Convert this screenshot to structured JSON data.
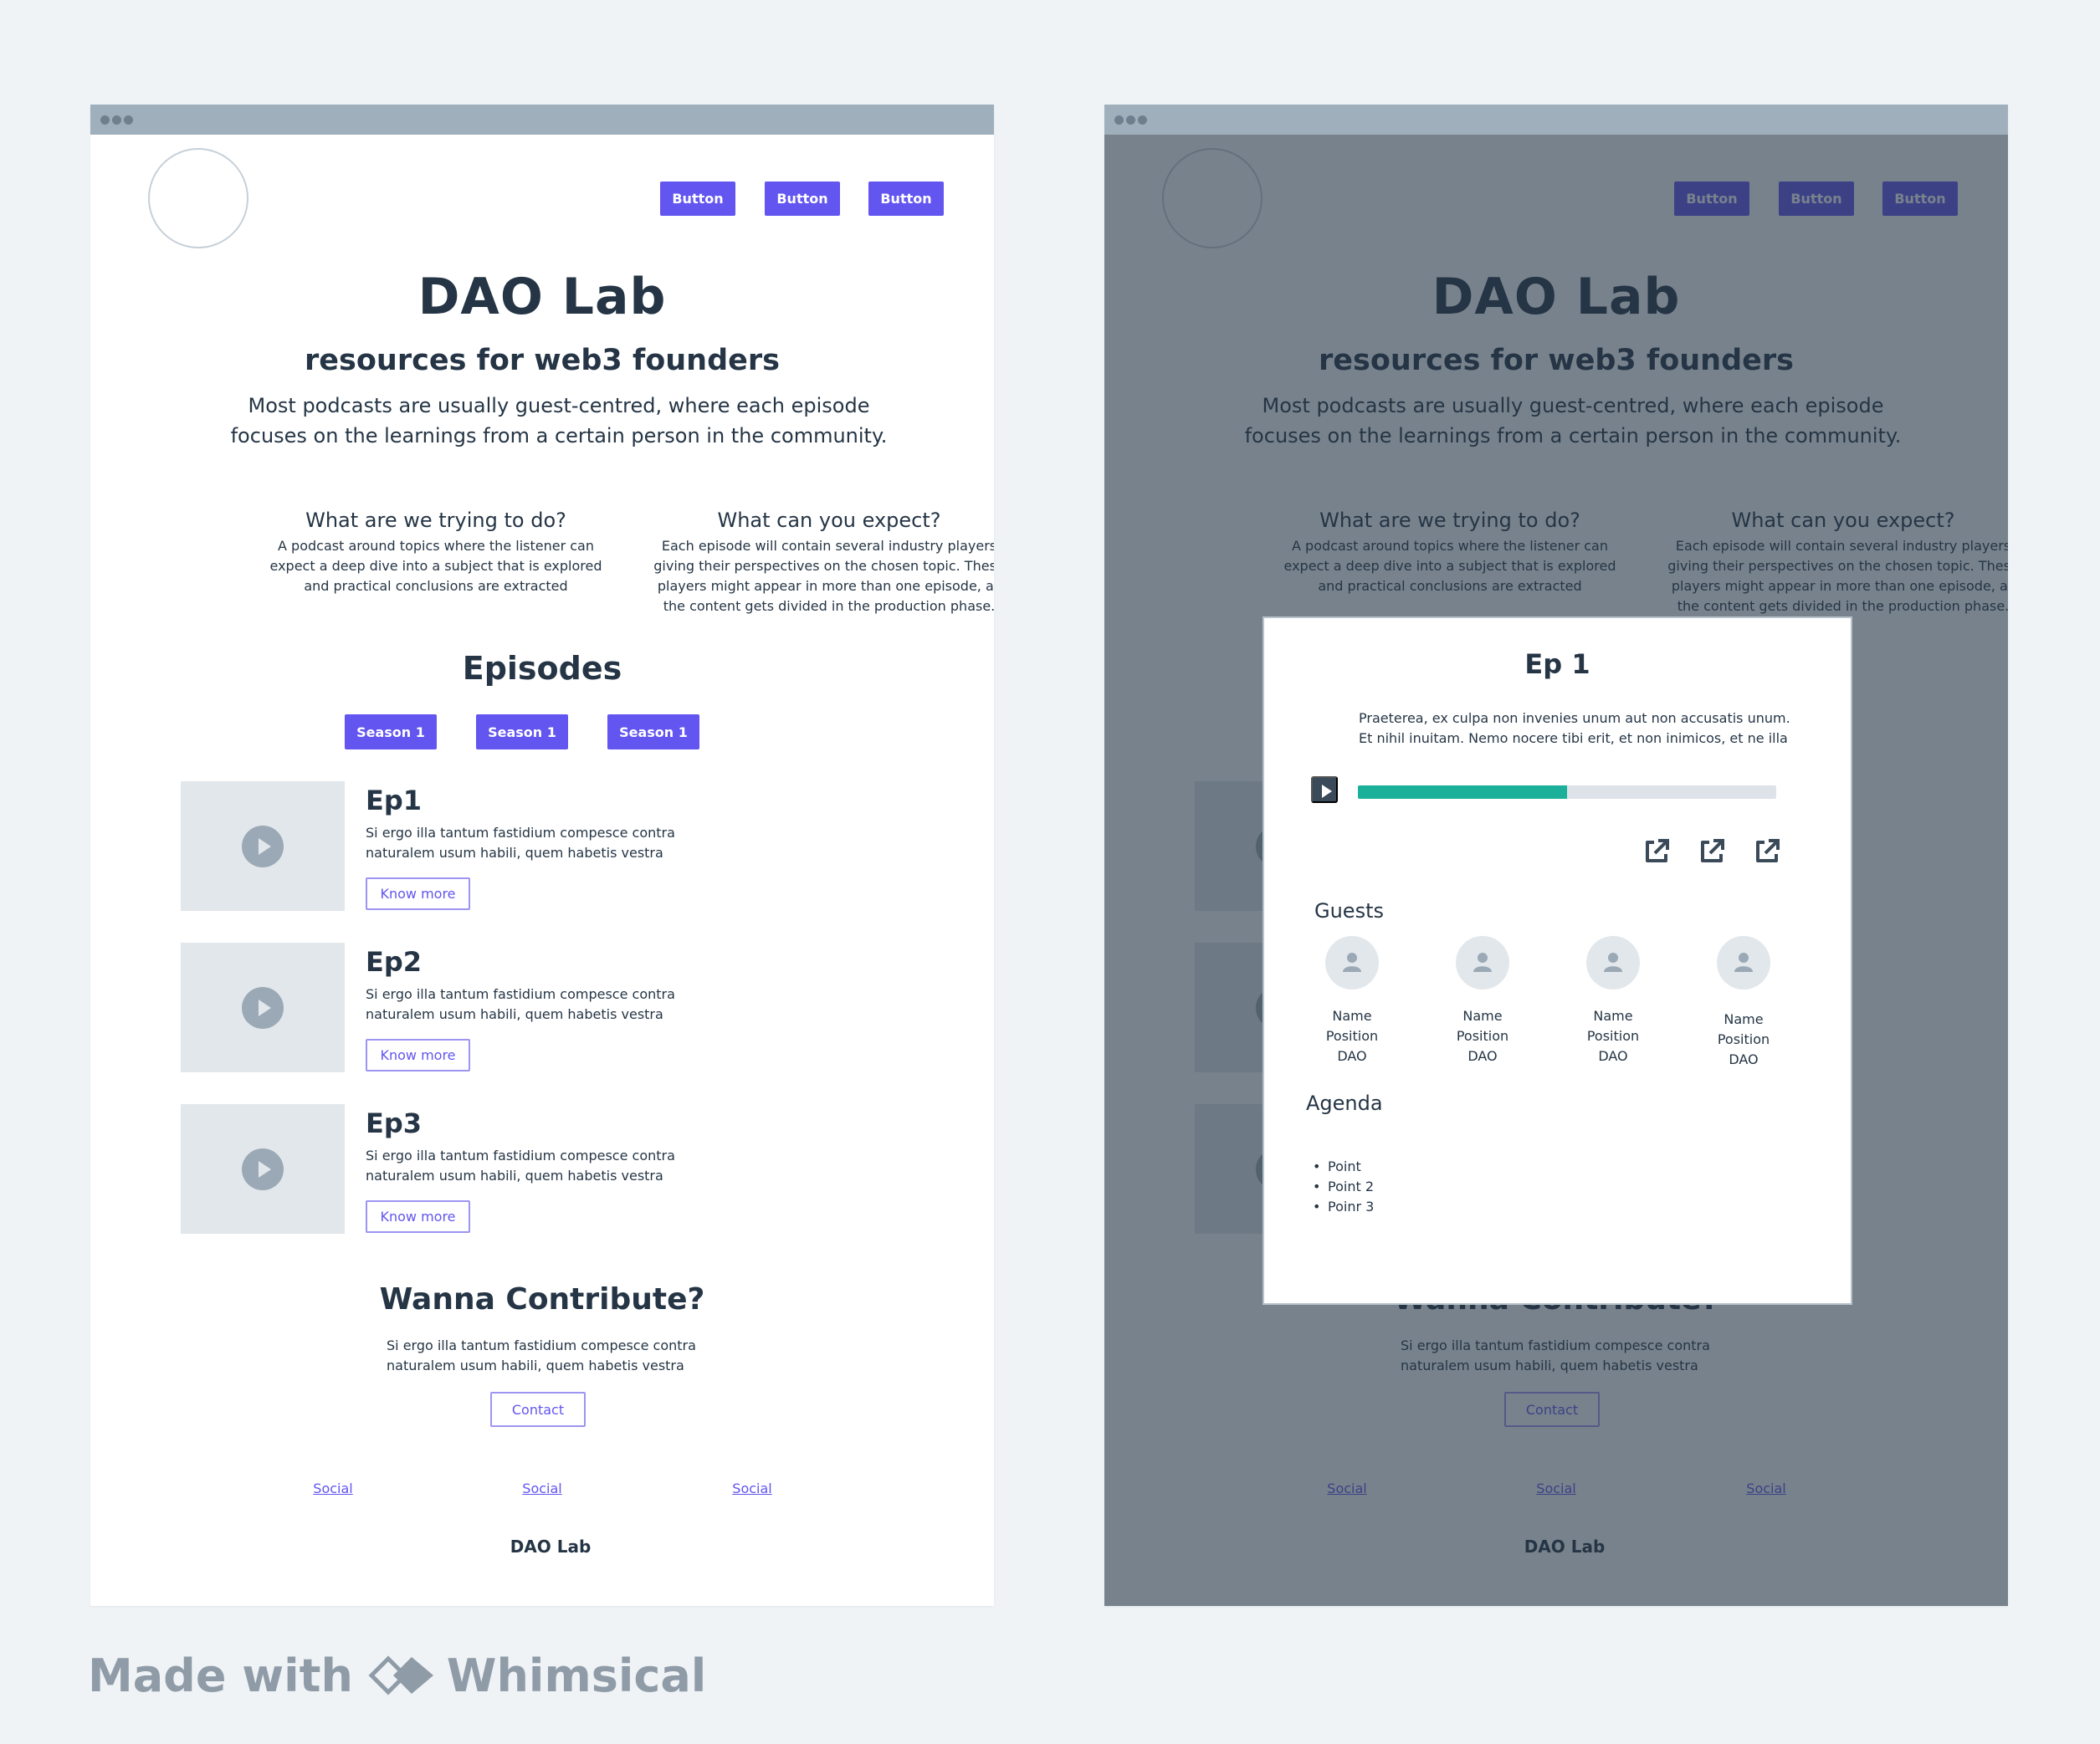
{
  "header": {
    "buttons": [
      "Button",
      "Button",
      "Button"
    ]
  },
  "hero": {
    "title": "DAO Lab",
    "subtitle": "resources for web3 founders",
    "description_line1": "Most podcasts are usually guest-centred, where each episode",
    "description_line2": "focuses on the learnings from a certain person in the community."
  },
  "info": [
    {
      "heading": "What are we trying to do?",
      "lines": [
        "A podcast around topics where the listener can",
        "expect a deep dive into a subject that is explored",
        "and practical conclusions are extracted"
      ]
    },
    {
      "heading": "What can you expect?",
      "lines": [
        "Each episode will contain several industry players",
        "giving their perspectives on the chosen topic. These",
        "players might appear in more than one episode, as",
        "the content gets divided in the production phase."
      ]
    }
  ],
  "episodes": {
    "heading": "Episodes",
    "seasons": [
      "Season 1",
      "Season 1",
      "Season 1"
    ],
    "items": [
      {
        "title": "Ep1",
        "line1": "Si ergo illa tantum fastidium compesce contra",
        "line2": "naturalem usum habili, quem habetis vestra",
        "button": "Know more"
      },
      {
        "title": "Ep2",
        "line1": "Si ergo illa tantum fastidium compesce contra",
        "line2": "naturalem usum habili, quem habetis vestra",
        "button": "Know more"
      },
      {
        "title": "Ep3",
        "line1": "Si ergo illa tantum fastidium compesce contra",
        "line2": "naturalem usum habili, quem habetis vestra",
        "button": "Know more"
      }
    ]
  },
  "contribute": {
    "heading": "Wanna Contribute?",
    "line1": "Si ergo illa tantum fastidium compesce contra",
    "line2": "naturalem usum habili, quem habetis vestra",
    "button": "Contact"
  },
  "footer": {
    "socials": [
      "Social",
      "Social",
      "Social"
    ],
    "brand": "DAO Lab"
  },
  "modal": {
    "title": "Ep 1",
    "desc_line1": "Praeterea, ex culpa non invenies unum aut non accusatis unum.",
    "desc_line2": "Et nihil inuitam. Nemo nocere tibi erit, et non inimicos, et ne illa",
    "progress": 0.5,
    "share_icons": [
      "external-link-icon",
      "external-link-icon",
      "external-link-icon"
    ],
    "guests_heading": "Guests",
    "guests": [
      {
        "name": "Name",
        "position": "Position",
        "org": "DAO"
      },
      {
        "name": "Name",
        "position": "Position",
        "org": "DAO"
      },
      {
        "name": "Name",
        "position": "Position",
        "org": "DAO"
      },
      {
        "name": "Name",
        "position": "Position",
        "org": "DAO"
      }
    ],
    "agenda_heading": "Agenda",
    "agenda": [
      "Point",
      "Point 2",
      "Poinr 3"
    ]
  },
  "watermark": {
    "prefix": "Made with",
    "brand": "Whimsical"
  },
  "colors": {
    "accent": "#6255f0",
    "progress": "#1ab09a",
    "overlay": "#253545",
    "background": "#eff3f6"
  }
}
